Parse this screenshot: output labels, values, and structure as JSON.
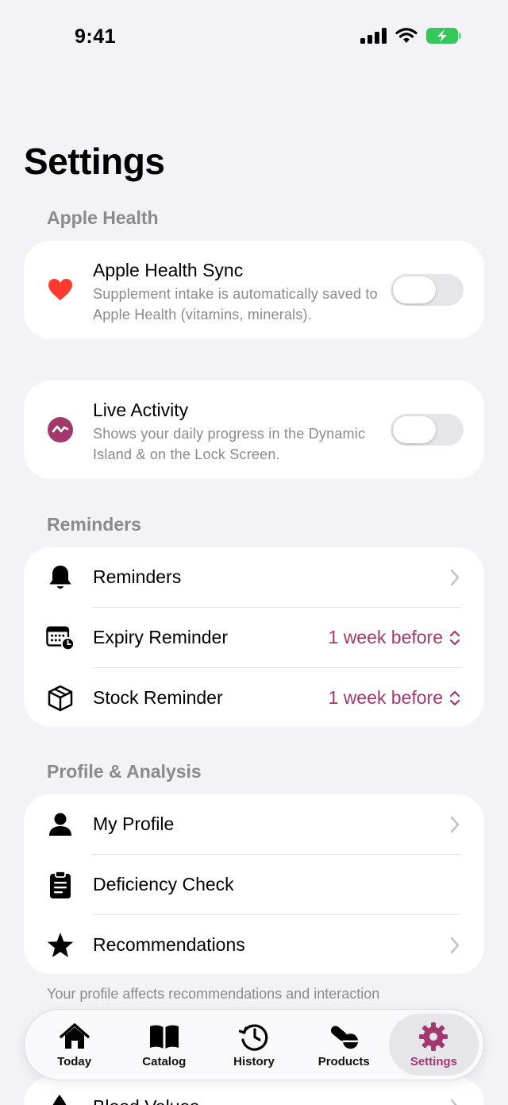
{
  "status_bar": {
    "time": "9:41"
  },
  "page_title": "Settings",
  "sections": {
    "apple_health": {
      "header": "Apple Health",
      "sync_title": "Apple Health Sync",
      "sync_subtitle": "Supplement intake is automatically saved to Apple Health (vitamins, minerals).",
      "sync_enabled": false
    },
    "live_activity": {
      "title": "Live Activity",
      "subtitle": "Shows your daily progress in the Dynamic Island & on the Lock Screen.",
      "enabled": false
    },
    "reminders": {
      "header": "Reminders",
      "items": [
        {
          "label": "Reminders",
          "icon": "bell-icon"
        },
        {
          "label": "Expiry Reminder",
          "icon": "calendar-clock-icon",
          "value": "1 week before"
        },
        {
          "label": "Stock Reminder",
          "icon": "box-icon",
          "value": "1 week before"
        }
      ]
    },
    "profile": {
      "header": "Profile & Analysis",
      "items": [
        {
          "label": "My Profile",
          "icon": "person-icon"
        },
        {
          "label": "Deficiency Check",
          "icon": "clipboard-icon"
        },
        {
          "label": "Recommendations",
          "icon": "star-icon"
        }
      ],
      "footer": "Your profile affects recommendations and interaction"
    },
    "peek": {
      "label": "Blood Values"
    }
  },
  "tab_bar": {
    "tabs": [
      {
        "label": "Today",
        "icon": "house-icon"
      },
      {
        "label": "Catalog",
        "icon": "book-icon"
      },
      {
        "label": "History",
        "icon": "history-icon"
      },
      {
        "label": "Products",
        "icon": "pills-icon"
      },
      {
        "label": "Settings",
        "icon": "gear-icon",
        "active": true
      }
    ]
  },
  "colors": {
    "accent": "#a3386f",
    "heart": "#ff3b30",
    "background": "#f2f2f7"
  }
}
